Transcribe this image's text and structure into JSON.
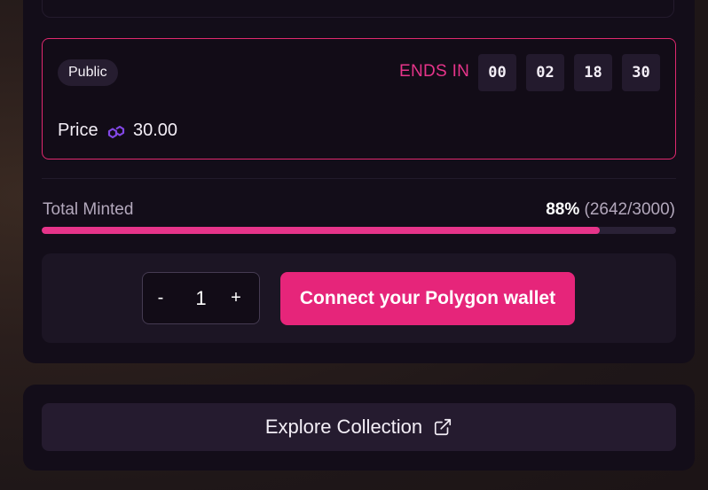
{
  "phase": {
    "badge": "Public",
    "ends_label": "ENDS IN",
    "countdown": [
      "00",
      "02",
      "18",
      "30"
    ],
    "price_label": "Price",
    "price_icon": "polygon-matic-icon",
    "price_value": "30.00"
  },
  "minted": {
    "label": "Total Minted",
    "percent_text": "88%",
    "count_text": "(2642/3000)",
    "progress_fraction": 0.88
  },
  "mint": {
    "minus_label": "-",
    "quantity": "1",
    "plus_label": "+",
    "connect_label": "Connect your Polygon wallet"
  },
  "explore": {
    "label": "Explore Collection",
    "icon": "external-link-icon"
  },
  "colors": {
    "accent": "#e6257a",
    "card_bg": "#130d19",
    "polygon_purple": "#8247e5"
  }
}
